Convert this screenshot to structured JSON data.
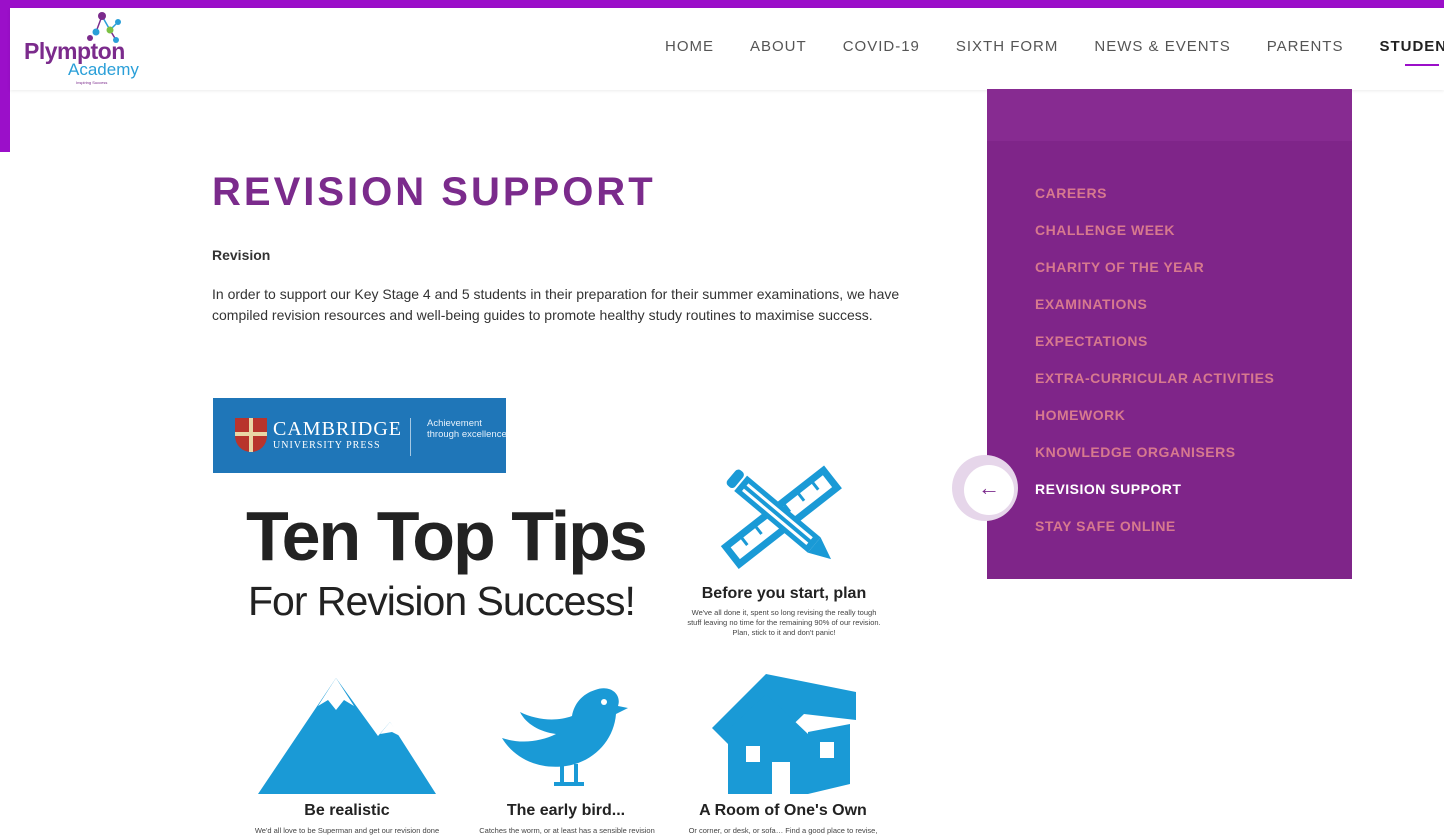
{
  "brand": {
    "logo_name": "Plympton",
    "logo_sub": "Academy",
    "logo_tag": "Inspiring Success",
    "accent": "#9b0fc9",
    "primary_purple": "#7b2b8c"
  },
  "nav": {
    "items": [
      "HOME",
      "ABOUT",
      "COVID-19",
      "SIXTH FORM",
      "NEWS & EVENTS",
      "PARENTS",
      "STUDENTS"
    ],
    "active": "STUDENTS"
  },
  "page": {
    "title": "REVISION SUPPORT",
    "section_heading": "Revision",
    "intro": "In order to support our Key Stage 4 and 5 students in their preparation for their summer examinations, we have compiled revision resources and well-being guides to promote healthy study routines to maximise success."
  },
  "infographic": {
    "publisher_name": "CAMBRIDGE",
    "publisher_sub": "UNIVERSITY PRESS",
    "publisher_tagline": "Achievement through excellence",
    "headline": "Ten Top Tips",
    "subheadline": "For Revision Success!",
    "tips": [
      {
        "title": "Before you start, plan",
        "desc": "We've all done it, spent so long revising the really tough stuff leaving no time for the remaining 90% of our revision. Plan, stick to it and don't panic!",
        "icon": "pencil-ruler-icon"
      },
      {
        "title": "Be realistic",
        "desc": "We'd all love to be Superman and get our revision done",
        "icon": "mountain-icon"
      },
      {
        "title": "The early bird...",
        "desc": "Catches the worm, or at least has a sensible revision",
        "icon": "bird-icon"
      },
      {
        "title": "A Room of One's Own",
        "desc": "Or corner, or desk, or sofa… Find a good place to revise,",
        "icon": "house-icon"
      }
    ],
    "icon_color": "#1a9ad6"
  },
  "sidebar": {
    "items": [
      "CAREERS",
      "CHALLENGE WEEK",
      "CHARITY OF THE YEAR",
      "EXAMINATIONS",
      "EXPECTATIONS",
      "EXTRA-CURRICULAR ACTIVITIES",
      "HOMEWORK",
      "KNOWLEDGE ORGANISERS",
      "REVISION SUPPORT",
      "STAY SAFE ONLINE"
    ],
    "current": "REVISION SUPPORT",
    "back_icon": "arrow-left-icon",
    "link_color": "#d7798e"
  }
}
